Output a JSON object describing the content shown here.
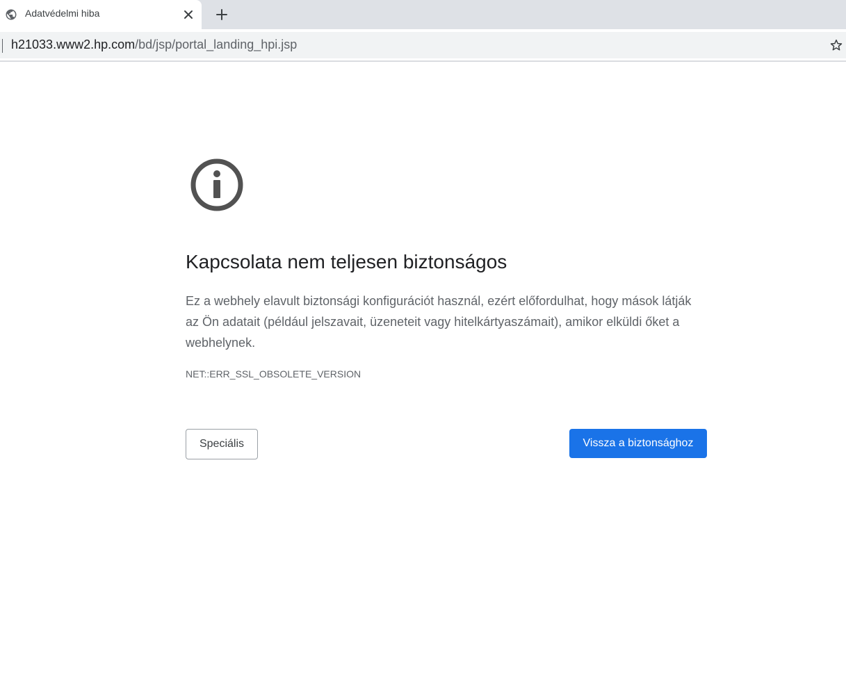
{
  "browser": {
    "tab": {
      "title": "Adatvédelmi hiba",
      "favicon": "globe-icon",
      "close_icon": "close-icon"
    },
    "new_tab_icon": "plus-icon",
    "address_bar": {
      "host": "h21033.www2.hp.com",
      "path": "/bd/jsp/portal_landing_hpi.jsp",
      "bookmark_icon": "star-icon"
    }
  },
  "interstitial": {
    "icon": "info-icon",
    "heading": "Kapcsolata nem teljesen biztonságos",
    "description": "Ez a webhely elavult biztonsági konfigurációt használ, ezért előfordulhat, hogy mások látják az Ön adatait (például jelszavait, üzeneteit vagy hitelkártyaszámait), amikor elküldi őket a webhelynek.",
    "error_code": "NET::ERR_SSL_OBSOLETE_VERSION",
    "advanced_button": "Speciális",
    "back_button": "Vissza a biztonsághoz"
  },
  "colors": {
    "primary_button": "#1a73e8",
    "tabstrip": "#dee1e6",
    "omnibox": "#f1f3f4",
    "icon": "#525252"
  }
}
